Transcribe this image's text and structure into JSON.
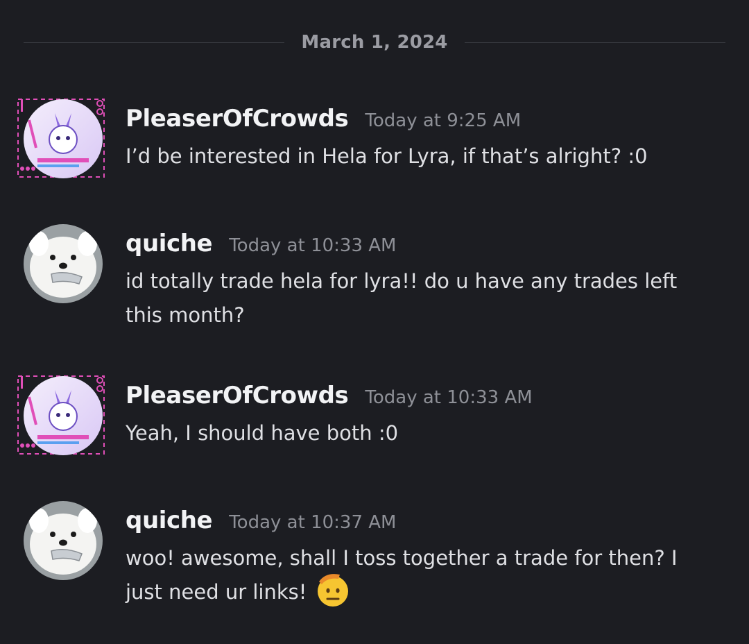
{
  "date_divider": {
    "label": "March 1, 2024"
  },
  "messages": [
    {
      "username": "PleaserOfCrowds",
      "timestamp": "Today at 9:25 AM",
      "avatar_icon": "anime-character-avatar",
      "lines": [
        "I’d be interested in Hela for Lyra, if that’s alright? :0"
      ]
    },
    {
      "username": "quiche",
      "timestamp": "Today at 10:33 AM",
      "avatar_icon": "white-dog-avatar",
      "lines": [
        "id totally trade hela for lyra!! do u have any trades left",
        "this month?"
      ]
    },
    {
      "username": "PleaserOfCrowds",
      "timestamp": "Today at 10:33 AM",
      "avatar_icon": "anime-character-avatar",
      "lines": [
        "Yeah, I should have both :0"
      ]
    },
    {
      "username": "quiche",
      "timestamp": "Today at 10:37 AM",
      "avatar_icon": "white-dog-avatar",
      "lines": [
        "woo! awesome, shall I toss together a trade for then? I",
        "just need ur links!"
      ],
      "trailing_emoji": "saluting-face-emoji"
    }
  ],
  "colors": {
    "background": "#1c1d22",
    "username": "#f2f3f5",
    "timestamp": "#8e9097",
    "text": "#dfe0e4",
    "divider": "#3b3d44",
    "frame_pink": "#e04fb8"
  }
}
